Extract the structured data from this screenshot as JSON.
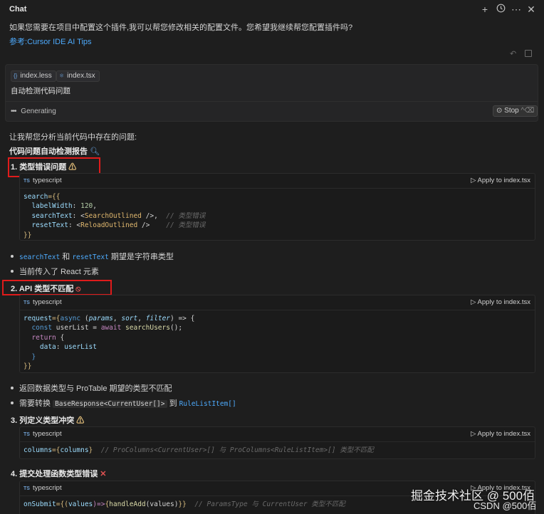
{
  "header": {
    "title": "Chat",
    "icons": [
      "plus-icon",
      "history-icon",
      "more-icon",
      "close-icon"
    ]
  },
  "intro": {
    "question": "如果您需要在项目中配置这个插件,我可以帮您修改相关的配置文件。您希望我继续帮您配置插件吗?",
    "ref_label": "参考:",
    "ref_link": "Cursor IDE AI Tips"
  },
  "context": {
    "files": [
      "index.less",
      "index.tsx"
    ],
    "prompt": "自动检测代码问题",
    "status": "Generating",
    "stop_label": "Stop",
    "stop_shortcut": "^⌫"
  },
  "analysis": {
    "intro": "让我帮您分析当前代码中存在的问题:",
    "report_title": "代码问题自动检测报告"
  },
  "code_lang": "typescript",
  "apply_label": "Apply to index.tsx",
  "sections": [
    {
      "heading": "1. 类型错误问题",
      "bullets": [
        {
          "code1": "searchText",
          "mid": "和",
          "code2": "resetText",
          "tail": "期望是字符串类型"
        },
        {
          "text": "当前传入了 React 元素"
        }
      ]
    },
    {
      "heading": "2. API 类型不匹配",
      "bullets": [
        {
          "text": "返回数据类型与 ProTable 期望的类型不匹配"
        },
        {
          "pre": "需要转换",
          "code1": "BaseResponse<CurrentUser[]>",
          "mid": "到",
          "code2": "RuleListItem[]"
        }
      ]
    },
    {
      "heading": "3. 列定义类型冲突"
    },
    {
      "heading": "4. 提交处理函数类型错误"
    }
  ],
  "code": {
    "block1": {
      "l1a": "search",
      "l1b": "={{",
      "l2a": "labelWidth",
      "l2b": ": ",
      "l2c": "120",
      "l2d": ",",
      "l3a": "searchText",
      "l3b": ": <",
      "l3c": "SearchOutlined",
      "l3d": " />,",
      "l3e": "// 类型错误",
      "l4a": "resetText",
      "l4b": ": <",
      "l4c": "ReloadOutlined",
      "l4d": " />",
      "l4e": "// 类型错误",
      "l5": "}}"
    },
    "block2": {
      "l1a": "request",
      "l1b": "={",
      "l1c": "async",
      "l1d": " (",
      "l1e": "params",
      "l1f": ", ",
      "l1g": "sort",
      "l1h": ", ",
      "l1i": "filter",
      "l1j": ") => {",
      "l2a": "const",
      "l2b": " userList = ",
      "l2c": "await",
      "l2d": " searchUsers",
      "l2e": "();",
      "l3a": "return",
      "l3b": " {",
      "l4a": "data",
      "l4b": ": ",
      "l4c": "userList",
      "l5": "}",
      "l6": "}}"
    },
    "block3": {
      "a": "columns",
      "b": "={",
      "c": "columns",
      "d": "}",
      "e": "// ProColumns<CurrentUser>[] 与 ProColumns<RuleListItem>[] 类型不匹配"
    },
    "block4": {
      "a": "onSubmit",
      "b": "={(",
      "c": "values",
      "d": ")=>",
      "e": "{",
      "f": "handleAdd",
      "g": "(values)",
      "h": "}}",
      "i": "// ParamsType 与 CurrentUser 类型不匹配"
    }
  },
  "watermark": {
    "line1": "掘金技术社区 @ 500佰",
    "line2": "CSDN @500佰"
  },
  "colors": {
    "background": "#1e1e1e",
    "link": "#4daafc",
    "highlight_box": "#e01b1b",
    "warning": "#e5c07b",
    "error": "#e05252"
  }
}
